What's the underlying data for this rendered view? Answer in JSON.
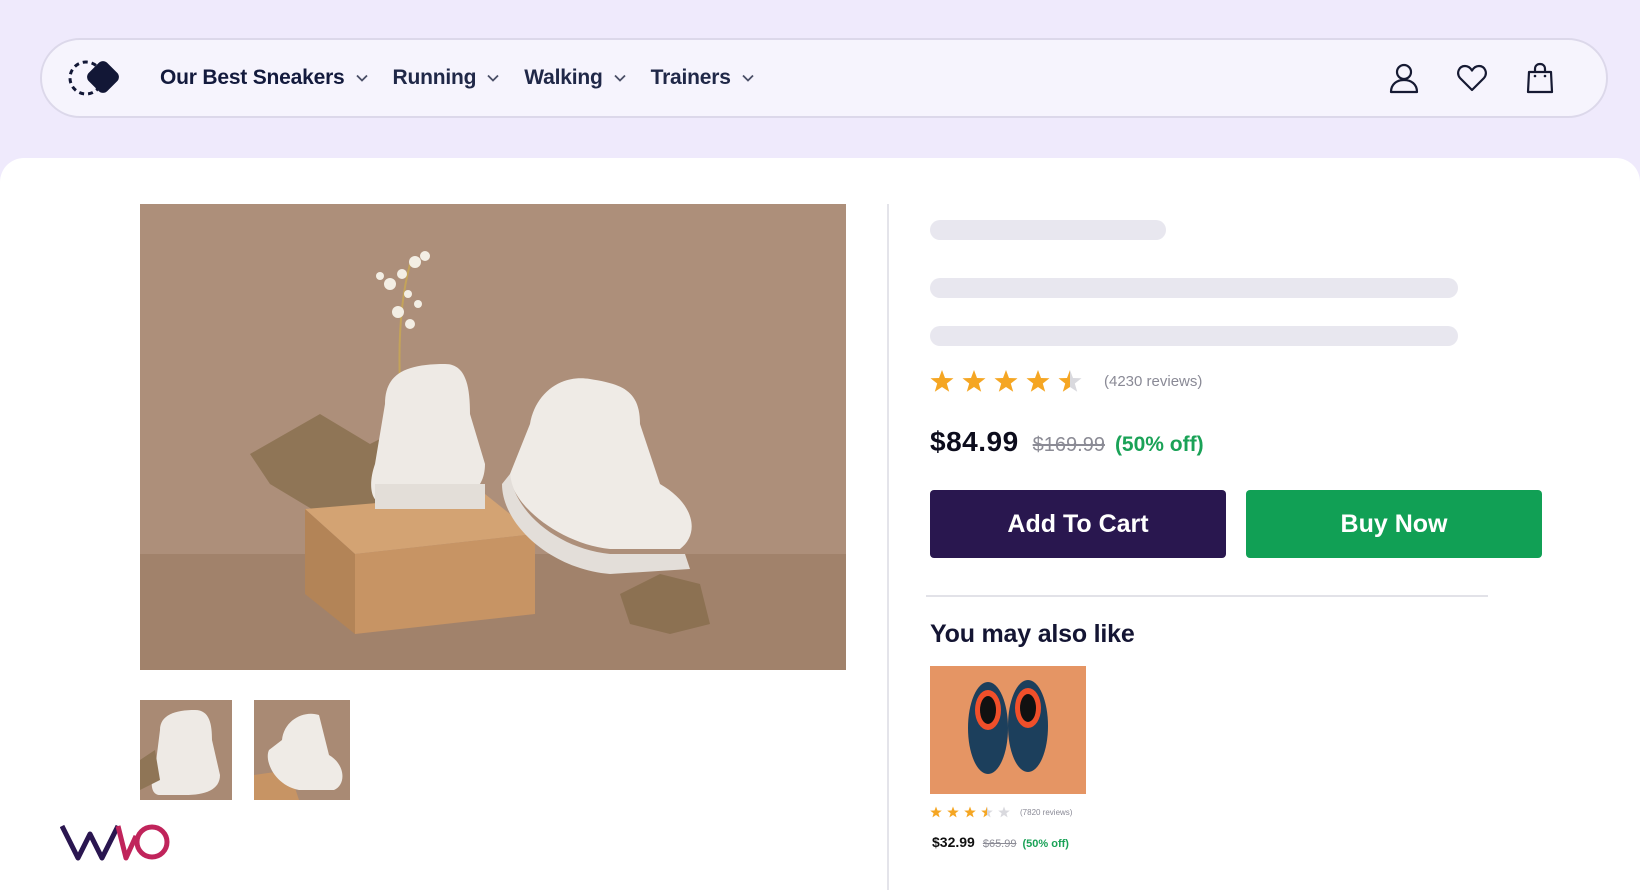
{
  "nav": {
    "menu": [
      {
        "label": "Our Best Sneakers"
      },
      {
        "label": "Running"
      },
      {
        "label": "Walking"
      },
      {
        "label": "Trainers"
      }
    ],
    "icons": [
      "user-icon",
      "heart-icon",
      "shopping-bag-icon"
    ]
  },
  "product": {
    "rating": 4.5,
    "reviews": "(4230 reviews)",
    "price": "$84.99",
    "old_price": "$169.99",
    "discount": "(50% off)",
    "add_to_cart": "Add To Cart",
    "buy_now": "Buy Now"
  },
  "recommendations": {
    "title": "You may also like",
    "items": [
      {
        "rating": 3.5,
        "reviews": "(7820 reviews)",
        "price": "$32.99",
        "old_price": "$65.99",
        "discount": "(50% off)"
      }
    ]
  },
  "colors": {
    "brand_dark": "#29174f",
    "buy_green": "#11a055",
    "star": "#f5a623",
    "page_bg": "#efeafc"
  }
}
